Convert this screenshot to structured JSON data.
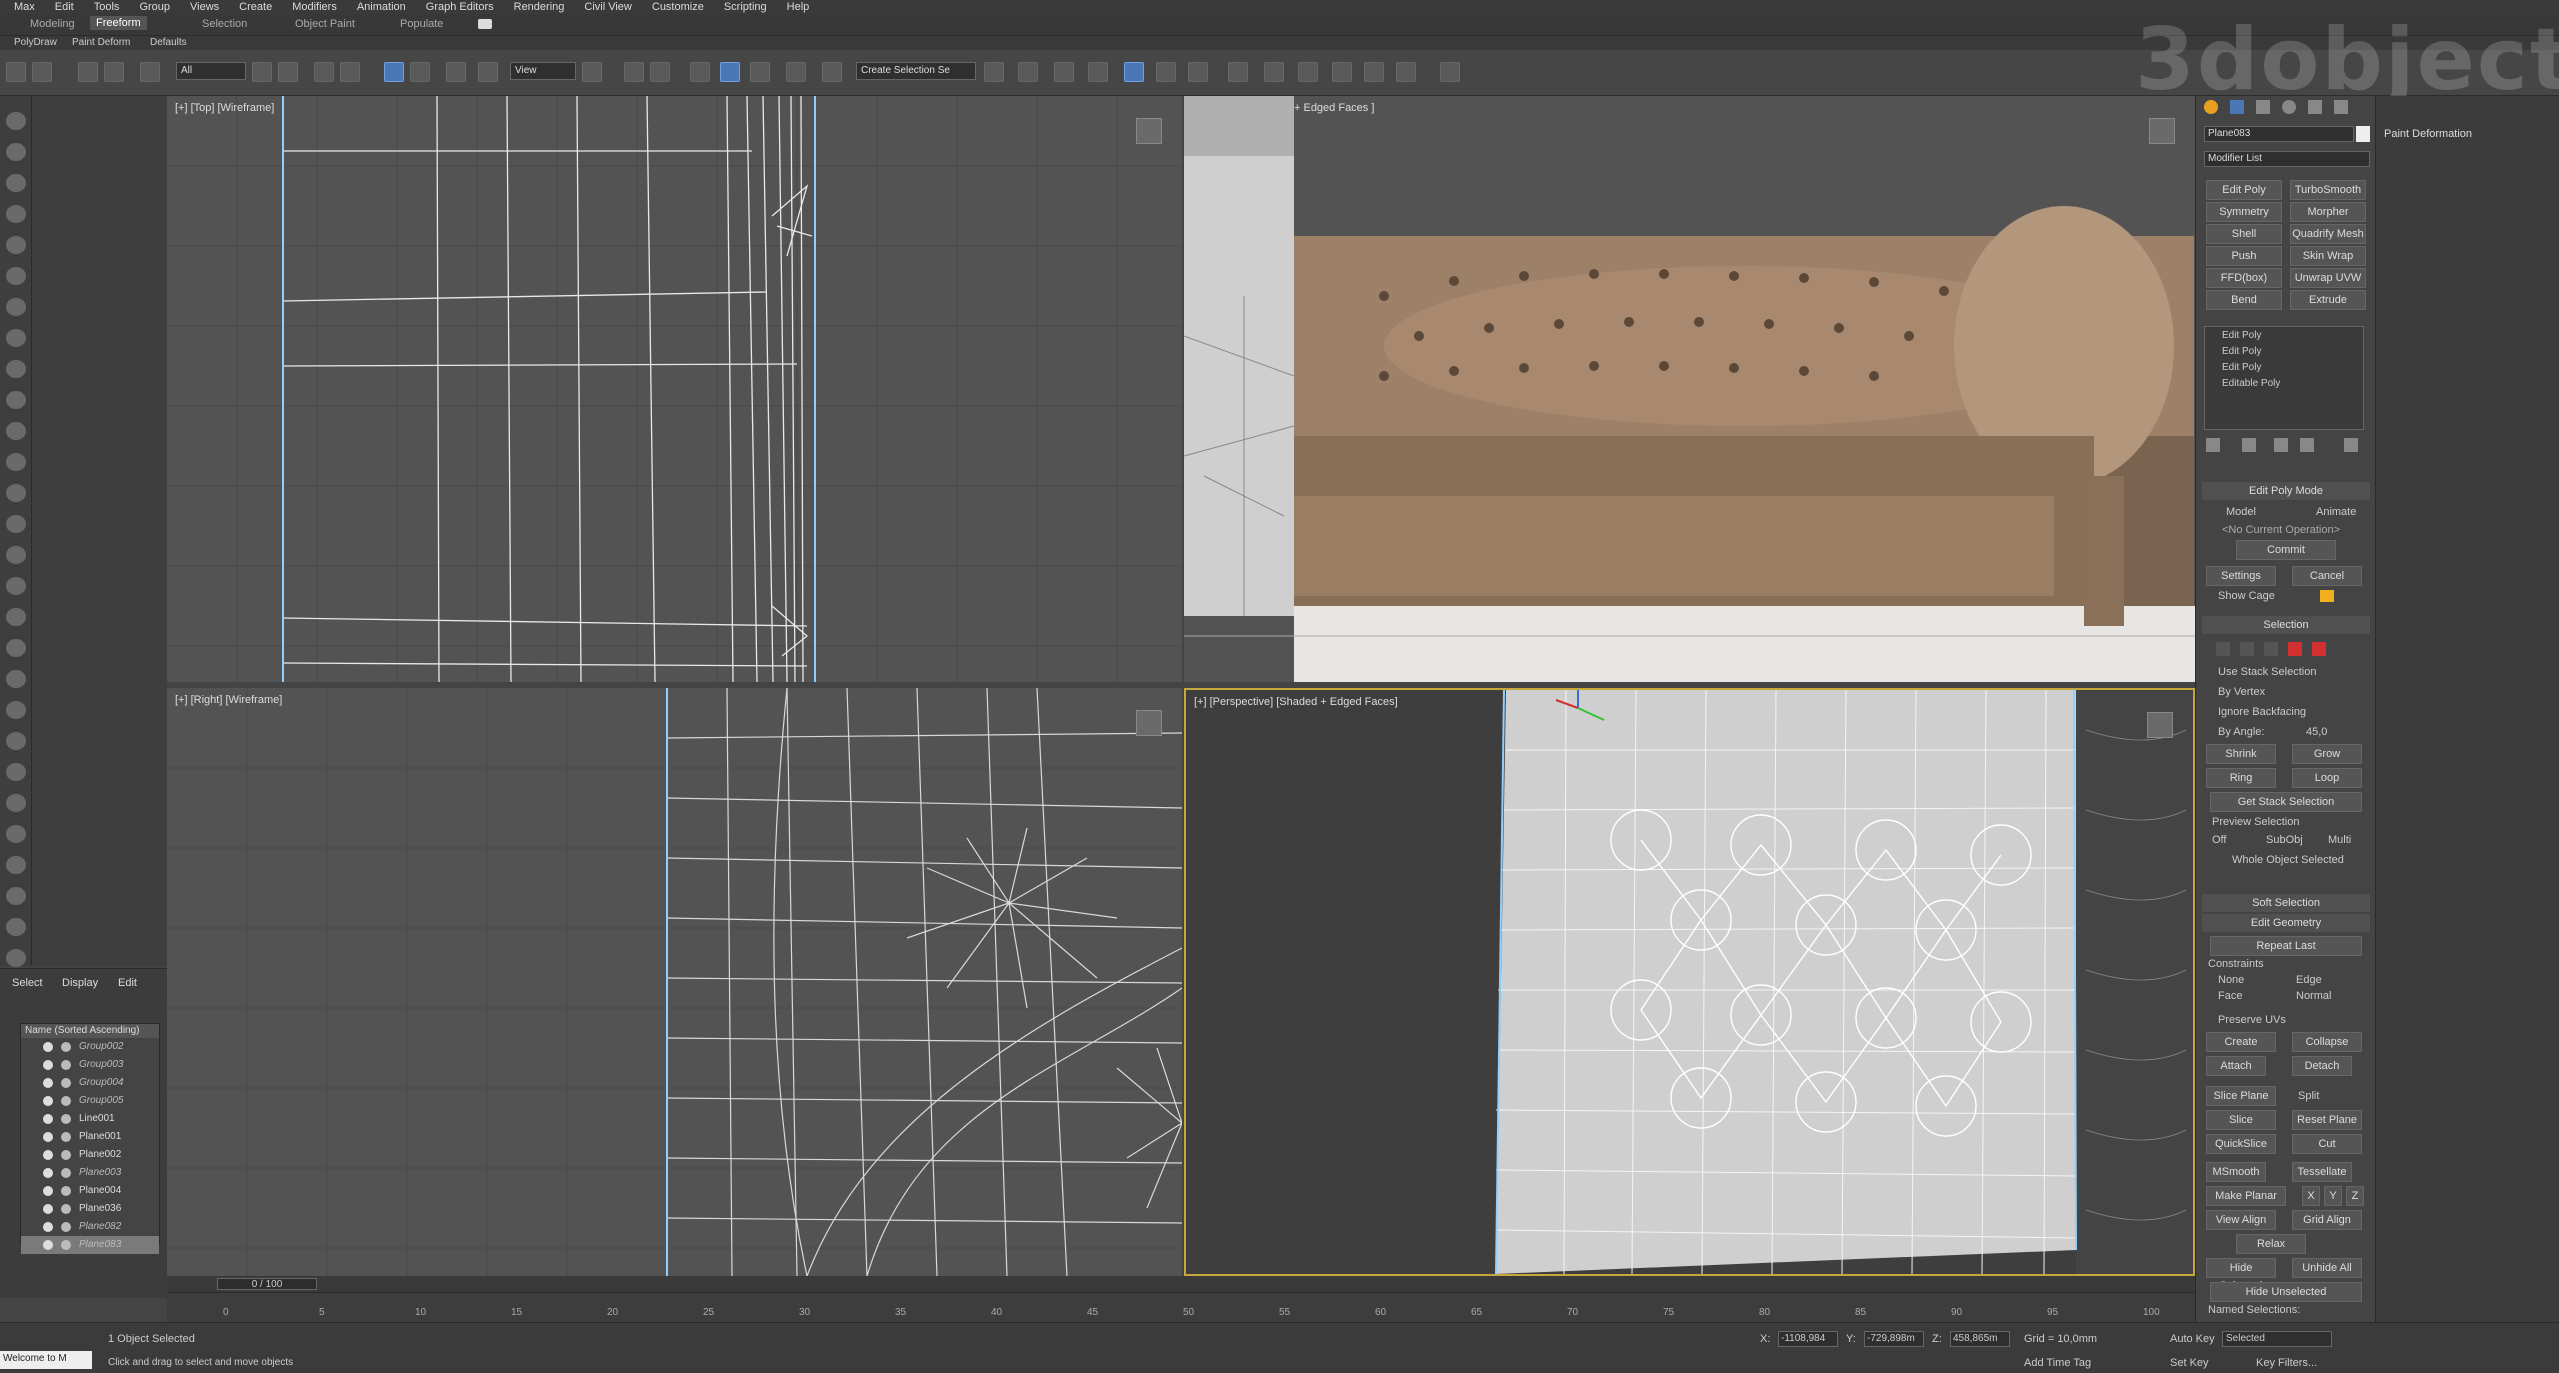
{
  "menu": [
    "Max",
    "Edit",
    "Tools",
    "Group",
    "Views",
    "Create",
    "Modifiers",
    "Animation",
    "Graph Editors",
    "Rendering",
    "Civil View",
    "Customize",
    "Scripting",
    "Help"
  ],
  "ribbon_tabs": [
    "Modeling",
    "Freeform",
    "Selection",
    "Object Paint",
    "Populate"
  ],
  "ribbon_active": "Freeform",
  "subribbon": [
    "PolyDraw",
    "Paint Deform",
    "Defaults"
  ],
  "toolbar": {
    "selection_filter": "All",
    "ref_coord": "View",
    "named_selection": "Create Selection Se"
  },
  "watermark": "3dobject",
  "viewports": {
    "top": "[+] [Top] [Wireframe]",
    "front": "+ Edged Faces ]",
    "right": "[+] [Right] [Wireframe]",
    "persp": "[+] [Perspective] [Shaded + Edged Faces]"
  },
  "scene_explorer": {
    "tabs": [
      "Select",
      "Display",
      "Edit"
    ],
    "header": "Name (Sorted Ascending)",
    "items": [
      {
        "name": "Group002",
        "group": true
      },
      {
        "name": "Group003",
        "group": true
      },
      {
        "name": "Group004",
        "group": true
      },
      {
        "name": "Group005",
        "group": true
      },
      {
        "name": "Line001",
        "group": false
      },
      {
        "name": "Plane001",
        "group": false
      },
      {
        "name": "Plane002",
        "group": false
      },
      {
        "name": "Plane003",
        "group": true
      },
      {
        "name": "Plane004",
        "group": false
      },
      {
        "name": "Plane036",
        "group": false
      },
      {
        "name": "Plane082",
        "group": true
      },
      {
        "name": "Plane083",
        "group": true,
        "selected": true
      }
    ]
  },
  "timeline": {
    "slider": "0 / 100",
    "ticks": [
      "0",
      "5",
      "10",
      "15",
      "20",
      "25",
      "30",
      "35",
      "40",
      "45",
      "50",
      "55",
      "60",
      "65",
      "70",
      "75",
      "80",
      "85",
      "90",
      "95",
      "100"
    ]
  },
  "status": {
    "script": "Welcome to M",
    "selected": "1 Object Selected",
    "prompt": "Click and drag to select and move objects",
    "x_label": "X:",
    "x": "-1108,984",
    "y_label": "Y:",
    "y": "-729,898m",
    "z_label": "Z:",
    "z": "458,865m",
    "grid": "Grid = 10,0mm",
    "addtime": "Add Time Tag",
    "autokey": "Auto Key",
    "setkey": "Set Key",
    "key_mode": "Selected",
    "keyfilters": "Key Filters..."
  },
  "command_panel": {
    "object_name": "Plane083",
    "modifier_list": "Modifier List",
    "buttons": [
      [
        "Edit Poly",
        "TurboSmooth"
      ],
      [
        "Symmetry",
        "Morpher"
      ],
      [
        "Shell",
        "Quadrify Mesh"
      ],
      [
        "Push",
        "Skin Wrap"
      ],
      [
        "FFD(box)",
        "Unwrap UVW"
      ],
      [
        "Bend",
        "Extrude"
      ]
    ],
    "stack": [
      "Edit Poly",
      "Edit Poly",
      "Edit Poly",
      "Editable Poly"
    ],
    "edit_poly_mode": "Edit Poly Mode",
    "model": "Model",
    "animate": "Animate",
    "no_op": "<No Current Operation>",
    "commit": "Commit",
    "settings": "Settings",
    "cancel": "Cancel",
    "show_cage": "Show Cage",
    "selection": "Selection",
    "use_stack": "Use Stack Selection",
    "by_vertex": "By Vertex",
    "ignore_bf": "Ignore Backfacing",
    "by_angle": "By Angle:",
    "angle_val": "45,0",
    "shrink": "Shrink",
    "grow": "Grow",
    "ring": "Ring",
    "loop": "Loop",
    "get_stack": "Get Stack Selection",
    "preview": "Preview Selection",
    "off": "Off",
    "subobj": "SubObj",
    "multi": "Multi",
    "whole": "Whole Object Selected",
    "soft": "Soft Selection",
    "edit_geom": "Edit Geometry",
    "repeat": "Repeat Last",
    "constraints": "Constraints",
    "none": "None",
    "edge": "Edge",
    "face": "Face",
    "normal": "Normal",
    "preserve": "Preserve UVs",
    "create": "Create",
    "collapse": "Collapse",
    "attach": "Attach",
    "detach": "Detach",
    "slice_plane": "Slice Plane",
    "split": "Split",
    "slice": "Slice",
    "reset_plane": "Reset Plane",
    "quickslice": "QuickSlice",
    "cut": "Cut",
    "msmooth": "MSmooth",
    "tessellate": "Tessellate",
    "make_planar": "Make Planar",
    "x": "X",
    "y": "Y",
    "z": "Z",
    "view_align": "View Align",
    "grid_align": "Grid Align",
    "relax": "Relax",
    "hide_sel": "Hide Selected",
    "unhide_all": "Unhide All",
    "hide_unsel": "Hide Unselected",
    "named_sel": "Named Selections:"
  },
  "paint_panel": {
    "title": "Paint Deformation"
  },
  "colors": {
    "accent": "#4a78b6",
    "active_viewport": "#c6a73a",
    "selection_red": "#d23030",
    "cage_orange": "#f0b020"
  }
}
